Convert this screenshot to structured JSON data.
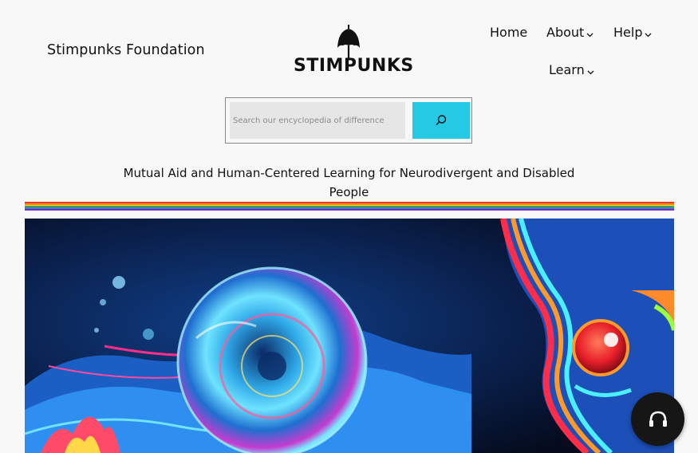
{
  "header": {
    "site_title": "Stimpunks Foundation",
    "logo_text": "STIMPUNKS",
    "logo_icon": "umbrella-icon"
  },
  "nav": {
    "home": "Home",
    "about": "About",
    "help": "Help",
    "learn": "Learn"
  },
  "search": {
    "placeholder": "Search our encyclopedia of difference",
    "value": "",
    "button_icon": "search-icon",
    "button_color": "#25c9e4"
  },
  "tagline": "Mutual Aid and Human-Centered Learning for Neurodivergent and Disabled People",
  "rainbow_colors": [
    "#e53935",
    "#fb8c00",
    "#fdd835",
    "#43a047",
    "#1e88e5",
    "#8e24aa"
  ],
  "hero_image": "psychedelic-art-image",
  "fab_icon": "headphones-icon"
}
